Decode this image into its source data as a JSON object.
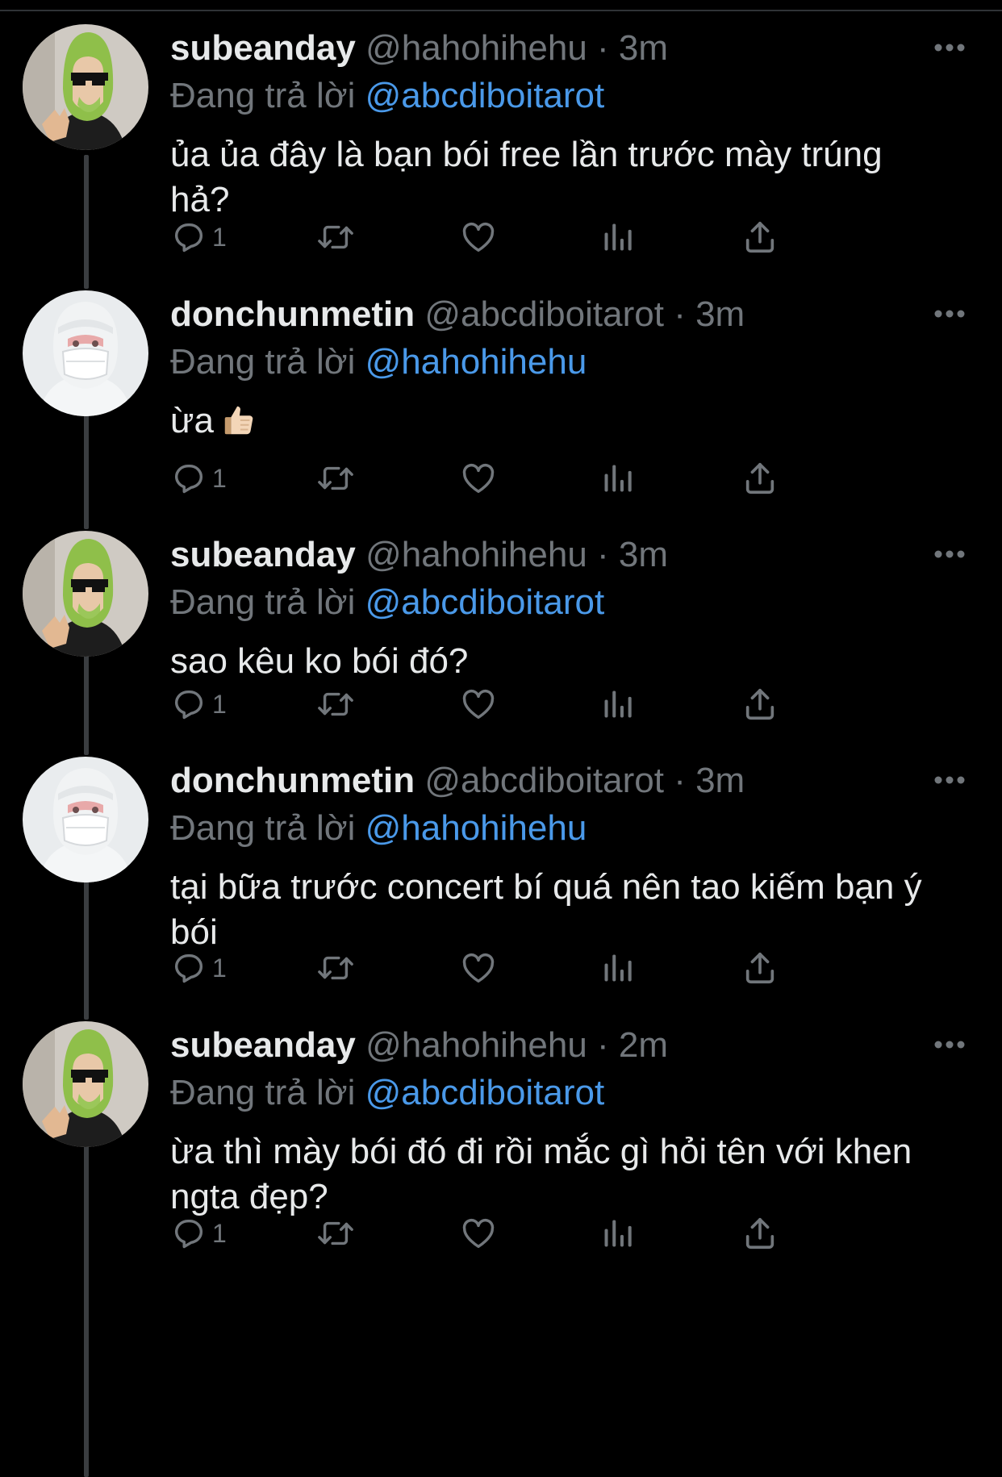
{
  "thread": [
    {
      "display_name": "subeanday",
      "handle": "@hahohihehu",
      "separator": "·",
      "time": "3m",
      "reply_prefix": "Đang trả lời",
      "reply_to": "@abcdiboitarot",
      "text": "ủa ủa đây là bạn bói free lần trước mày trúng hả?",
      "reply_count": "1",
      "avatar": "avocado-hat-avatar"
    },
    {
      "display_name": "donchunmetin",
      "handle": "@abcdiboitarot",
      "separator": "·",
      "time": "3m",
      "reply_prefix": "Đang trả lời",
      "reply_to": "@hahohihehu",
      "text": "ừa",
      "emoji": "thumbs-up",
      "reply_count": "1",
      "avatar": "white-hood-mask-avatar"
    },
    {
      "display_name": "subeanday",
      "handle": "@hahohihehu",
      "separator": "·",
      "time": "3m",
      "reply_prefix": "Đang trả lời",
      "reply_to": "@abcdiboitarot",
      "text": "sao kêu ko bói đó?",
      "reply_count": "1",
      "avatar": "avocado-hat-avatar"
    },
    {
      "display_name": "donchunmetin",
      "handle": "@abcdiboitarot",
      "separator": "·",
      "time": "3m",
      "reply_prefix": "Đang trả lời",
      "reply_to": "@hahohihehu",
      "text": "tại bữa trước concert bí quá nên tao kiếm bạn ý bói",
      "reply_count": "1",
      "avatar": "white-hood-mask-avatar"
    },
    {
      "display_name": "subeanday",
      "handle": "@hahohihehu",
      "separator": "·",
      "time": "2m",
      "reply_prefix": "Đang trả lời",
      "reply_to": "@abcdiboitarot",
      "text": "ừa thì mày bói đó đi rồi mắc gì hỏi tên với khen ngta đẹp?",
      "reply_count": "1",
      "avatar": "avocado-hat-avatar"
    }
  ],
  "colors": {
    "background": "#000000",
    "primary_text": "#e7e9ea",
    "secondary_text": "#71767b",
    "mention": "#4a99e9",
    "thread_line": "#3a3d40"
  },
  "icons": [
    "reply-icon",
    "retweet-icon",
    "like-icon",
    "views-icon",
    "share-icon",
    "more-icon"
  ]
}
